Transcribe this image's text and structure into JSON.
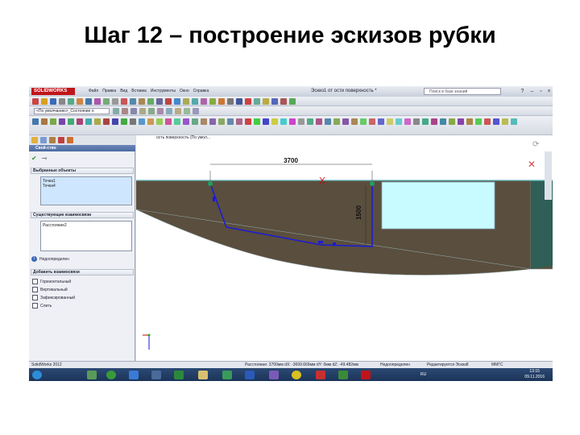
{
  "slide": {
    "title": "Шаг 12 – построение эскизов рубки"
  },
  "app": {
    "logo": "SOLIDWORKS",
    "menu": [
      "Файл",
      "Правка",
      "Вид",
      "Вставка",
      "Инструменты",
      "Окно",
      "Справка"
    ],
    "document_title": "Эскиз1 от ости поверхность *",
    "search_placeholder": "Поиск в базе знаний",
    "config_select": "<По умолчанию>_Состояние о",
    "colors": {
      "title_accent": "#c0141a",
      "sketch_line": "#1a1ad8",
      "ground": "#5a4e3e",
      "hull": "#2f5f56",
      "taskbar": "#1c3458"
    }
  },
  "panel": {
    "header": "Свой-ство",
    "selected_section": "Выбранные объекты",
    "selected_items": [
      "Точка1",
      "Точка4"
    ],
    "relations_section": "Существующие взаимосвязи",
    "relations_items": [
      "Расстояние2"
    ],
    "status_note": "Недоопределен",
    "add_section": "Добавить взаимосвязи",
    "add_options": [
      "Горизонтальный",
      "Вертикальный",
      "Зафиксированный",
      "Слить"
    ]
  },
  "viewport": {
    "label": "ость поверхность (По умол...",
    "dim_horizontal": "3700",
    "dim_vertical": "1500"
  },
  "status": {
    "app_version": "SolidWorks 2012",
    "measure": "Расстояние: 3700мм  dX: -3699.669мм  dY: 0мм  dZ: -49.482мм",
    "state": "Недоопределен",
    "mode": "Редактируется Эскиз8",
    "units": "ММГС"
  },
  "taskbar": {
    "lang": "RU",
    "time": "13:15",
    "date": "09.11.2016"
  }
}
